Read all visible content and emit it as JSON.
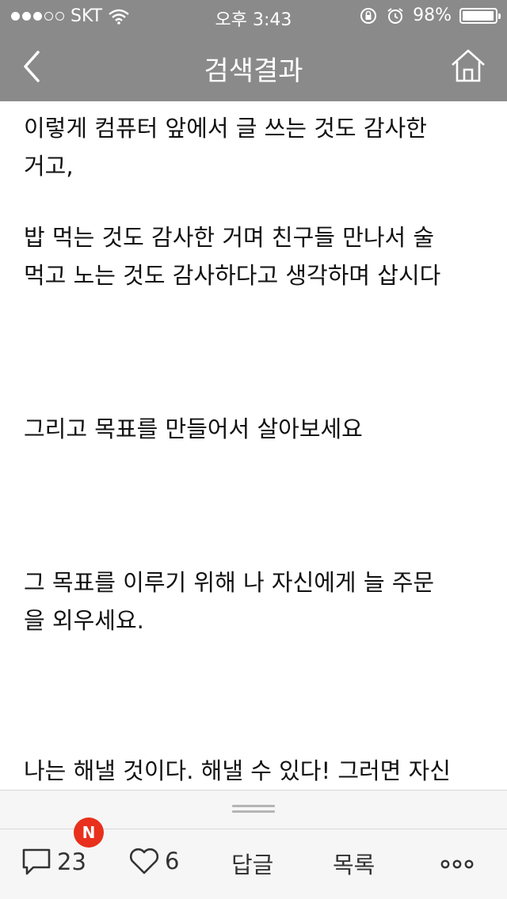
{
  "status_bar": {
    "carrier": "SKT",
    "signal_bars_filled": 3,
    "signal_bars_total": 5,
    "time": "오후 3:43",
    "battery_percent": "98%",
    "battery_level": 0.98
  },
  "nav": {
    "title": "검색결과",
    "back_icon": "chevron-left-icon",
    "home_icon": "home-icon"
  },
  "content": {
    "paragraphs": [
      "이렇게 컴퓨터 앞에서 글 쓰는 것도 감사한",
      "거고,",
      "밥 먹는 것도 감사한 거며 친구들 만나서 술",
      "먹고 노는 것도 감사하다고 생각하며 삽시다",
      "그리고 목표를 만들어서 살아보세요",
      "그 목표를 이루기 위해 나 자신에게 늘 주문",
      "을 외우세요.",
      "나는 해낼 것이다. 해낼 수 있다! 그러면 자신"
    ]
  },
  "toolbar": {
    "comment_count": "23",
    "like_count": "6",
    "reply_label": "답글",
    "list_label": "목록",
    "new_badge": "N",
    "comment_icon": "comment-icon",
    "like_icon": "heart-icon",
    "more_icon": "more-dots-icon"
  }
}
